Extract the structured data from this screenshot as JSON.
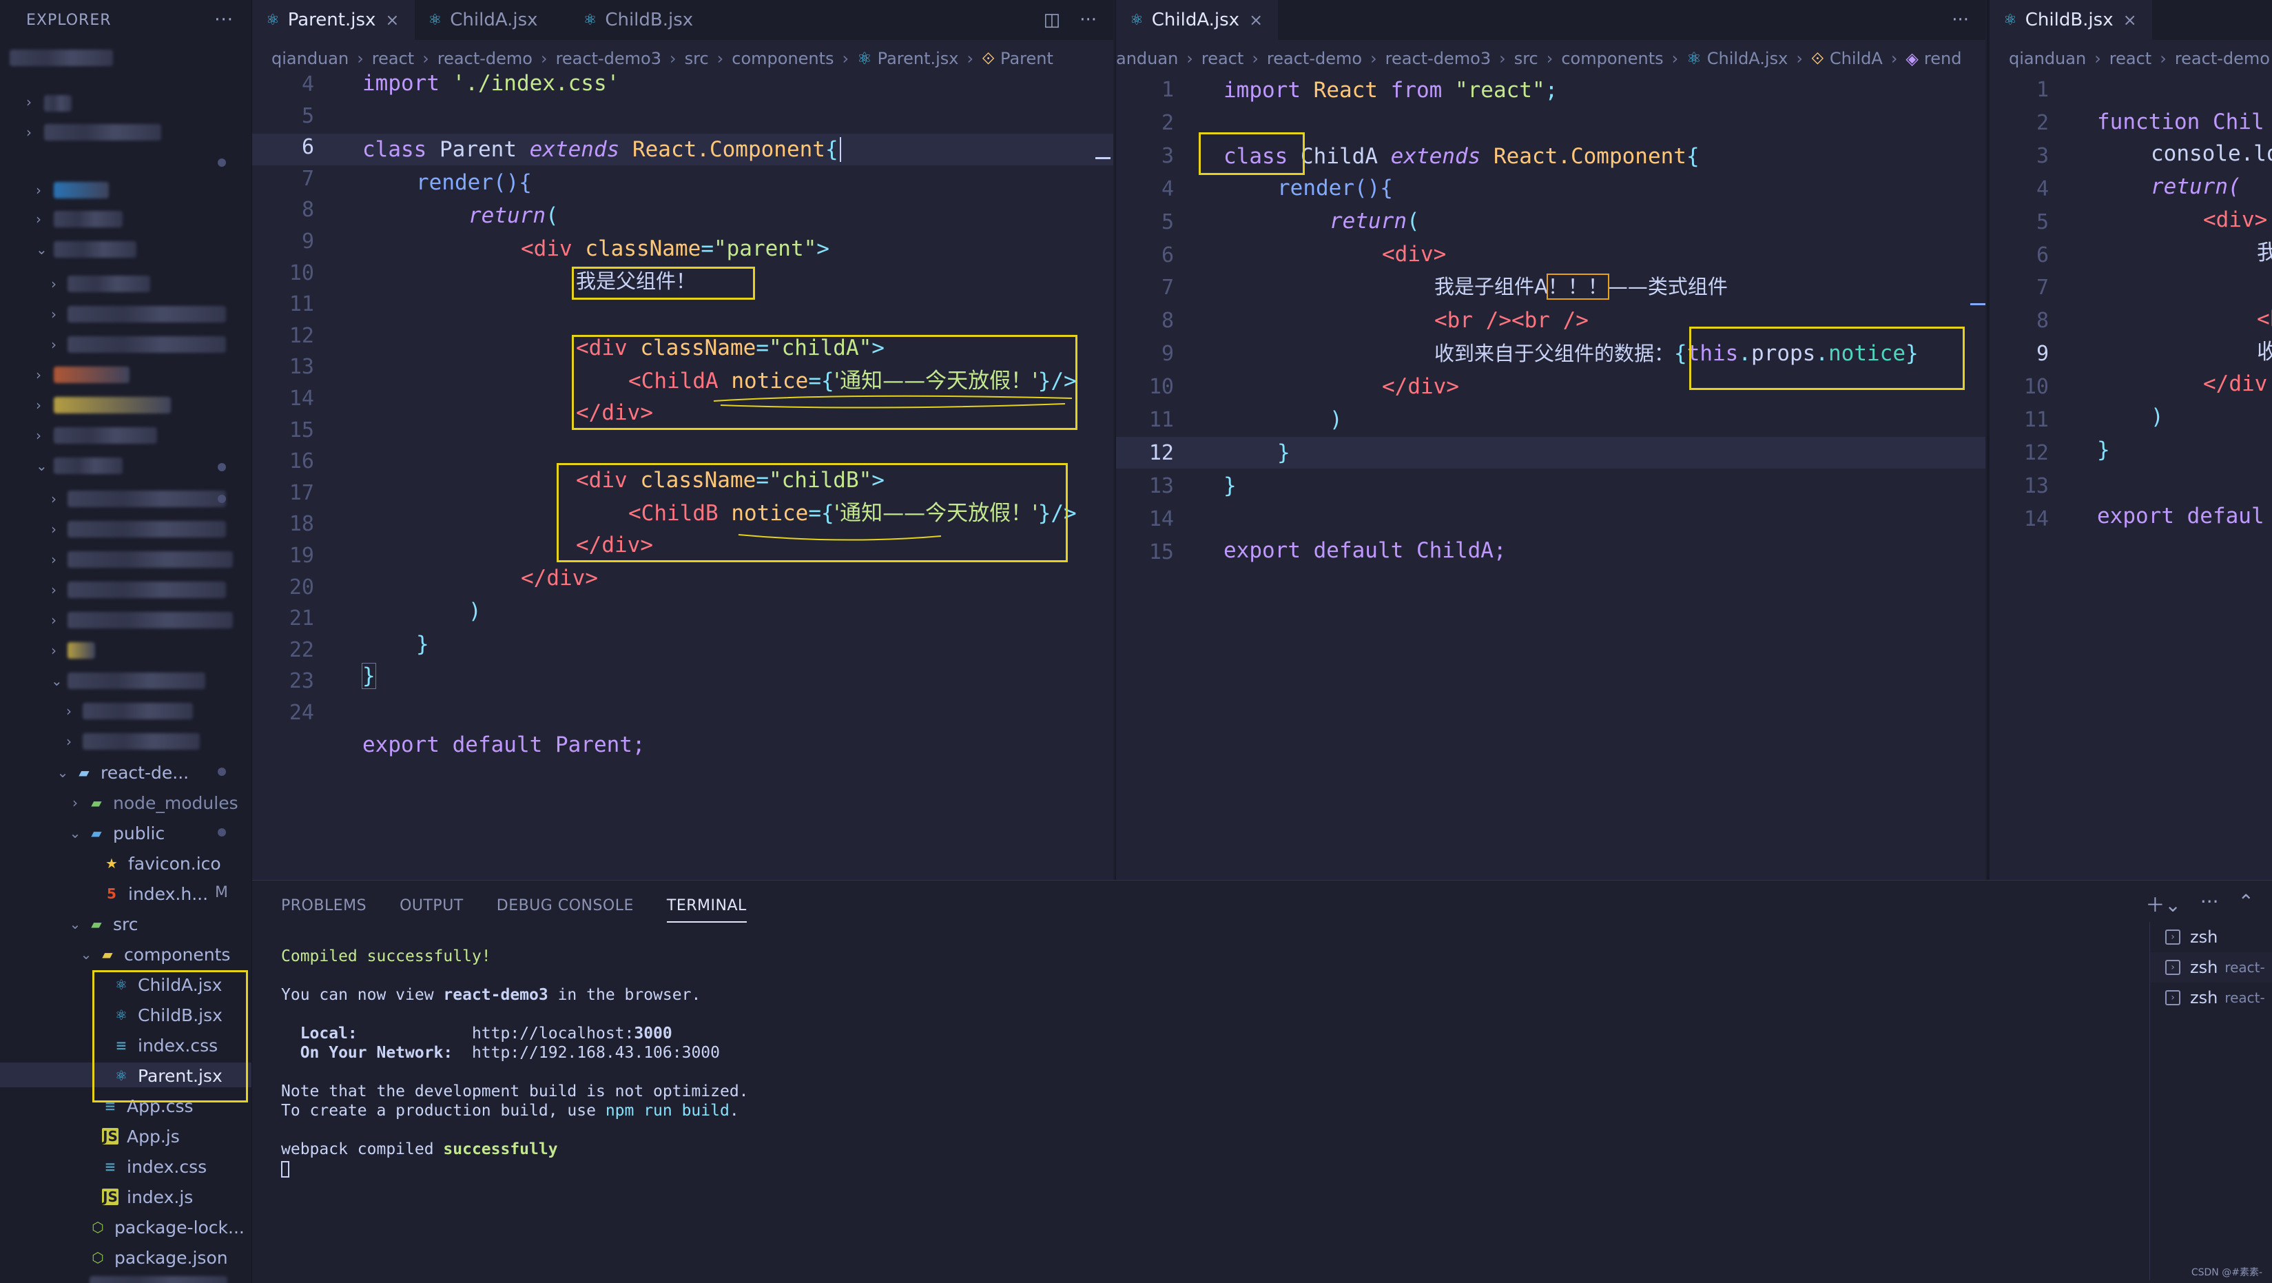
{
  "sidebar": {
    "title": "EXPLORER",
    "more_icon": "ellipsis-icon",
    "items": [
      {
        "label": "react-de...",
        "type": "folder",
        "expanded": true
      },
      {
        "label": "node_modules",
        "type": "folder-green",
        "expanded": false
      },
      {
        "label": "public",
        "type": "folder-blue",
        "expanded": true
      },
      {
        "label": "favicon.ico",
        "type": "star"
      },
      {
        "label": "index.h...",
        "type": "html",
        "badge": "M"
      },
      {
        "label": "src",
        "type": "folder-green",
        "expanded": true
      },
      {
        "label": "components",
        "type": "folder-yellow",
        "expanded": true
      },
      {
        "label": "ChildA.jsx",
        "type": "react"
      },
      {
        "label": "ChildB.jsx",
        "type": "react"
      },
      {
        "label": "index.css",
        "type": "css"
      },
      {
        "label": "Parent.jsx",
        "type": "react",
        "selected": true
      },
      {
        "label": "App.css",
        "type": "css"
      },
      {
        "label": "App.js",
        "type": "js"
      },
      {
        "label": "index.css",
        "type": "css"
      },
      {
        "label": "index.js",
        "type": "js"
      },
      {
        "label": "package-lock...",
        "type": "json"
      },
      {
        "label": "package.json",
        "type": "json"
      }
    ]
  },
  "group1": {
    "tabs": [
      {
        "label": "Parent.jsx",
        "active": true,
        "close": "×"
      },
      {
        "label": "ChildA.jsx",
        "active": false
      },
      {
        "label": "ChildB.jsx",
        "active": false
      }
    ],
    "breadcrumb": [
      "qianduan",
      "react",
      "react-demo",
      "react-demo3",
      "src",
      "components",
      "Parent.jsx",
      "Parent"
    ],
    "line_numbers": [
      "4",
      "5",
      "6",
      "7",
      "8",
      "9",
      "10",
      "11",
      "12",
      "13",
      "14",
      "15",
      "16",
      "17",
      "18",
      "19",
      "20",
      "21",
      "22",
      "23",
      "24"
    ],
    "cur_line": "6"
  },
  "group2": {
    "tabs": [
      {
        "label": "ChildA.jsx",
        "active": true,
        "close": "×"
      }
    ],
    "breadcrumb": [
      "anduan",
      "react",
      "react-demo",
      "react-demo3",
      "src",
      "components",
      "ChildA.jsx",
      "ChildA",
      "rend"
    ],
    "line_numbers": [
      "1",
      "2",
      "3",
      "4",
      "5",
      "6",
      "7",
      "8",
      "9",
      "10",
      "11",
      "12",
      "13",
      "14",
      "15"
    ],
    "cur_line": "12"
  },
  "group3": {
    "tabs": [
      {
        "label": "ChildB.jsx",
        "active": true,
        "close": "×"
      }
    ],
    "breadcrumb": [
      "qianduan",
      "react",
      "react-demo"
    ],
    "line_numbers": [
      "1",
      "2",
      "3",
      "4",
      "5",
      "6",
      "7",
      "8",
      "9",
      "10",
      "11",
      "12",
      "13",
      "14"
    ],
    "cur_line": "9"
  },
  "code": {
    "import": "import",
    "import_path": "'./index.css'",
    "class_kw": "class",
    "parent": "Parent",
    "extends": "extends",
    "react_component": "React.Component",
    "render": "render(){",
    "return": "return",
    "div_open": "<div",
    "classname": "className",
    "parent_class": "\"parent\"",
    "parent_text": "我是父组件！",
    "childA_class": "\"childA\"",
    "childB_class": "\"childB\"",
    "childA_tag": "<ChildA",
    "childB_tag": "<ChildB",
    "notice_attr": "notice",
    "notice_value": "'通知——今天放假！'",
    "div_close": "</div>",
    "export": "export default Parent;",
    "a_import": "import React from \"react\";",
    "a_class_name": "ChildA",
    "a_div": "<div>",
    "a_text1a": "我是子组件A",
    "a_text1b": "！！！",
    "a_text1c": "——类式组件",
    "a_br": "<br /><br />",
    "a_text2": "收到来自于父组件的数据：",
    "a_expr": "{this.props.notice}",
    "a_export": "export default ChildA;",
    "b_function": "function Chil",
    "b_console": "console.lo",
    "b_return": "return(",
    "b_div": "<div>",
    "b_char1": "我",
    "b_tag": "<b",
    "b_char2": "收",
    "b_div_close": "</div",
    "b_export": "export defaul"
  },
  "panel": {
    "tabs": [
      "PROBLEMS",
      "OUTPUT",
      "DEBUG CONSOLE",
      "TERMINAL"
    ],
    "active_tab": "TERMINAL",
    "terminal": {
      "compiled": "Compiled successfully!",
      "view_pre": "You can now view ",
      "view_app": "react-demo3",
      "view_post": " in the browser.",
      "local_label": "  Local:            ",
      "local_pre": "http://localhost:",
      "local_port": "3000",
      "network_label": "  On Your Network:  ",
      "network_url": "http://192.168.43.106:3000",
      "note1": "Note that the development build is not optimized.",
      "note2_pre": "To create a production build, use ",
      "note2_cmd": "npm run build",
      "note2_post": ".",
      "webpack_pre": "webpack compiled ",
      "webpack_ok": "successfully"
    },
    "terminals": [
      {
        "label": "zsh",
        "sub": ""
      },
      {
        "label": "zsh",
        "sub": "react-"
      },
      {
        "label": "zsh",
        "sub": "react-"
      }
    ]
  },
  "watermark": "CSDN @#素素-",
  "colors": {
    "highlight": "#e6d21a",
    "accent": "#4fc1e9"
  }
}
